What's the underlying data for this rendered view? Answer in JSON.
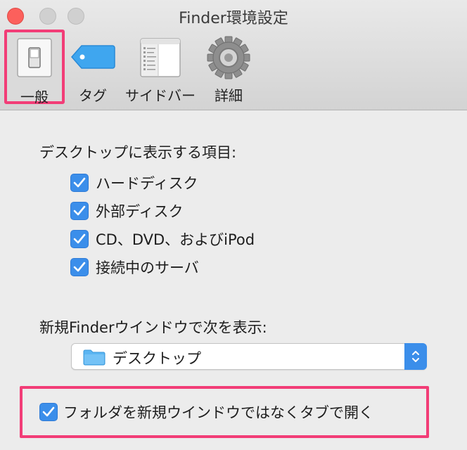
{
  "window": {
    "title": "Finder環境設定"
  },
  "toolbar": {
    "items": [
      {
        "label": "一般",
        "icon": "switch-icon",
        "selected": true
      },
      {
        "label": "タグ",
        "icon": "tag-icon",
        "selected": false
      },
      {
        "label": "サイドバー",
        "icon": "sidebar-icon",
        "selected": false
      },
      {
        "label": "詳細",
        "icon": "gear-icon",
        "selected": false
      }
    ]
  },
  "desktop_items": {
    "heading": "デスクトップに表示する項目:",
    "options": [
      {
        "label": "ハードディスク",
        "checked": true
      },
      {
        "label": "外部ディスク",
        "checked": true
      },
      {
        "label": "CD、DVD、およびiPod",
        "checked": true
      },
      {
        "label": "接続中のサーバ",
        "checked": true
      }
    ]
  },
  "new_window": {
    "heading": "新規Finderウインドウで次を表示:",
    "selected": "デスクトップ",
    "icon": "folder-icon"
  },
  "open_folders_in_tabs": {
    "label": "フォルダを新規ウインドウではなくタブで開く",
    "checked": true
  },
  "colors": {
    "accent": "#3b8eea",
    "highlight": "#f23d77",
    "close": "#fc605c"
  }
}
